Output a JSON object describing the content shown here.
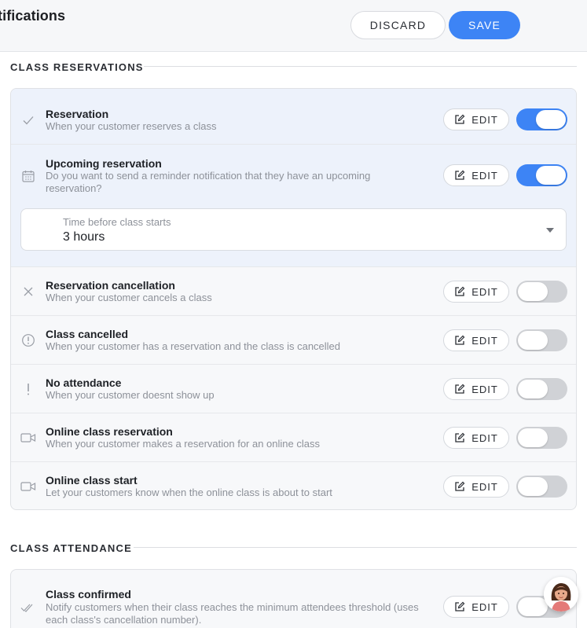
{
  "header": {
    "title": "tifications",
    "discard_label": "DISCARD",
    "save_label": "SAVE"
  },
  "sections": [
    {
      "heading": "CLASS RESERVATIONS",
      "rows": [
        {
          "title": "Reservation",
          "desc": "When your customer reserves a class",
          "icon": "check-icon",
          "edit_label": "EDIT",
          "enabled": true
        },
        {
          "title": "Upcoming reservation",
          "desc": "Do you want to send a reminder notification that they have an upcoming reservation?",
          "icon": "calendar-icon",
          "edit_label": "EDIT",
          "enabled": true,
          "select": {
            "label": "Time before class starts",
            "value": "3 hours"
          }
        },
        {
          "title": "Reservation cancellation",
          "desc": "When your customer cancels a class",
          "icon": "x-icon",
          "edit_label": "EDIT",
          "enabled": false
        },
        {
          "title": "Class cancelled",
          "desc": "When your customer has a reservation and the class is cancelled",
          "icon": "alert-circle-icon",
          "edit_label": "EDIT",
          "enabled": false
        },
        {
          "title": "No attendance",
          "desc": "When your customer doesnt show up",
          "icon": "exclamation-icon",
          "edit_label": "EDIT",
          "enabled": false
        },
        {
          "title": "Online class reservation",
          "desc": "When your customer makes a reservation for an online class",
          "icon": "video-icon",
          "edit_label": "EDIT",
          "enabled": false
        },
        {
          "title": "Online class start",
          "desc": "Let your customers know when the online class is about to start",
          "icon": "video-icon",
          "edit_label": "EDIT",
          "enabled": false
        }
      ]
    },
    {
      "heading": "CLASS ATTENDANCE",
      "rows": [
        {
          "title": "Class confirmed",
          "desc": "Notify customers when their class reaches the minimum attendees threshold (uses each class's cancellation number).",
          "icon": "double-check-icon",
          "edit_label": "EDIT",
          "enabled": false
        }
      ]
    }
  ],
  "colors": {
    "accent": "#3d84f5",
    "toggle_off": "#d0d2d6",
    "active_row": "#edf2fb"
  }
}
